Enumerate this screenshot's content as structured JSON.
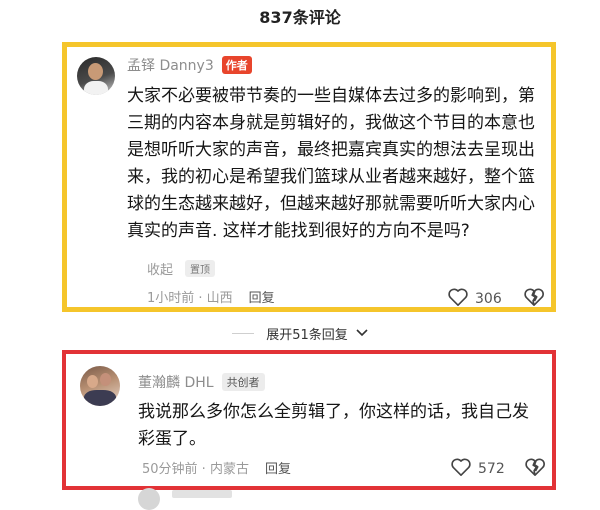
{
  "header": {
    "title": "837条评论"
  },
  "comments": [
    {
      "author": "孟铎 Danny3",
      "badge": "作者",
      "text": "大家不必要被带节奏的一些自媒体去过多的影响到，第三期的内容本身就是剪辑好的，我做这个节目的本意也是想听听大家的声音，最终把嘉宾真实的想法去呈现出来，我的初心是希望我们篮球从业者越来越好，整个篮球的生态越来越好，但越来越好那就需要听听大家内心真实的声音. 这样才能找到很好的方向不是吗?",
      "collapse_label": "收起",
      "pin_label": "置顶",
      "time_location": "1小时前 · 山西",
      "reply_label": "回复",
      "likes": "306",
      "highlight_color": "#f5c52b"
    },
    {
      "author": "董瀚麟 DHL",
      "badge": "共创者",
      "text": "我说那么多你怎么全剪辑了，你这样的话，我自己发彩蛋了。",
      "time_location": "50分钟前 · 内蒙古",
      "reply_label": "回复",
      "likes": "572",
      "highlight_color": "#e23236"
    }
  ],
  "expand": {
    "label": "展开51条回复",
    "icon": "chevron-down-icon"
  },
  "icons": {
    "like": "heart-icon",
    "dislike": "broken-heart-icon"
  }
}
